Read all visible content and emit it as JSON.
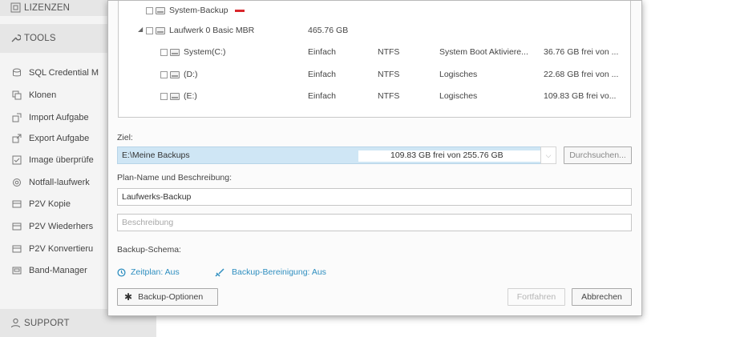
{
  "sidebar": {
    "licenses": "LIZENZEN",
    "tools": "TOOLS",
    "items": [
      "SQL Credential M",
      "Klonen",
      "Import Aufgabe",
      "Export Aufgabe",
      "Image überprüfe",
      "Notfall-laufwerk",
      "P2V Kopie",
      "P2V Wiederhers",
      "P2V Konvertieru",
      "Band-Manager"
    ],
    "support": "SUPPORT"
  },
  "tree": {
    "system_backup": "System-Backup",
    "disk0": {
      "name": "Laufwerk 0 Basic MBR",
      "size": "465.76 GB",
      "expander": "◢"
    },
    "partitions": [
      {
        "name": "System(C:)",
        "type": "Einfach",
        "fs": "NTFS",
        "status": "System Boot Aktiviere...",
        "free": "36.76 GB frei von ..."
      },
      {
        "name": "(D:)",
        "type": "Einfach",
        "fs": "NTFS",
        "status": "Logisches",
        "free": "22.68 GB frei von ..."
      },
      {
        "name": "(E:)",
        "type": "Einfach",
        "fs": "NTFS",
        "status": "Logisches",
        "free": "109.83 GB frei vo..."
      }
    ]
  },
  "form": {
    "target_label": "Ziel:",
    "target_value": "E:\\Meine Backups",
    "target_free": "109.83 GB frei von 255.76 GB",
    "browse": "Durchsuchen...",
    "plan_label": "Plan-Name und Beschreibung:",
    "plan_name": "Laufwerks-Backup",
    "description_placeholder": "Beschreibung",
    "schema_label": "Backup-Schema:",
    "schedule": "Zeitplan: Aus",
    "cleanup": "Backup-Bereinigung: Aus",
    "options": "Backup-Optionen",
    "continue": "Fortfahren",
    "cancel": "Abbrechen"
  },
  "colors": {
    "accent": "#2f8fc0",
    "selection": "#cfe6f5",
    "warning": "#d9262c"
  }
}
